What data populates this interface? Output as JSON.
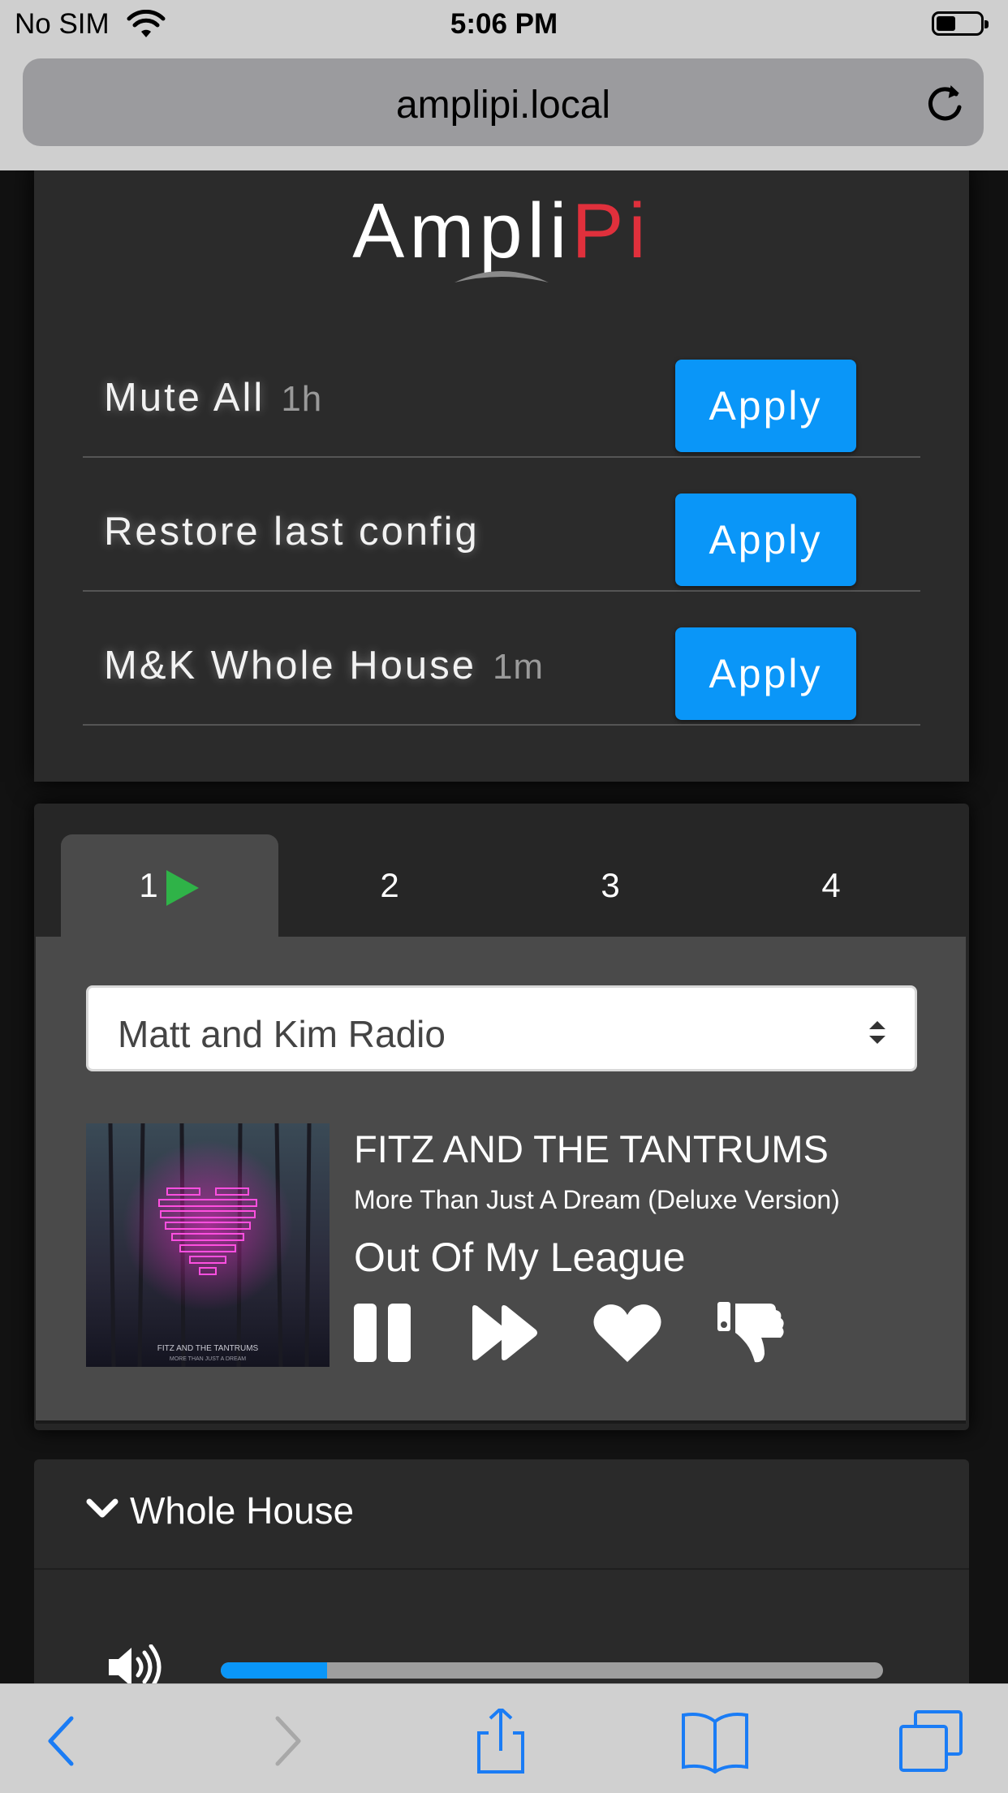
{
  "status_bar": {
    "carrier": "No SIM",
    "time": "5:06 PM",
    "battery_percent": 45
  },
  "browser": {
    "url": "amplipi.local"
  },
  "app": {
    "logo_main": "Ampli",
    "logo_accent": "Pi",
    "accent_color": "#e0303c",
    "button_color": "#0a96f8"
  },
  "presets": [
    {
      "name": "Mute All",
      "age": "1h",
      "button": "Apply"
    },
    {
      "name": "Restore last config",
      "age": "",
      "button": "Apply"
    },
    {
      "name": "M&K Whole House",
      "age": "1m",
      "button": "Apply"
    }
  ],
  "player": {
    "tabs": [
      "1",
      "2",
      "3",
      "4"
    ],
    "active_tab": "1",
    "source": "Matt and Kim Radio",
    "artist": "FITZ AND THE TANTRUMS",
    "album": "More Than Just A Dream (Deluxe Version)",
    "track": "Out Of My League",
    "art_text_line1": "FITZ AND THE TANTRUMS",
    "art_text_line2": "MORE THAN JUST A DREAM",
    "controls": [
      "pause-icon",
      "skip-forward-icon",
      "heart-icon",
      "thumbs-down-icon"
    ]
  },
  "zone_group": {
    "name": "Whole House",
    "volume_fraction": 0.16
  },
  "toolbar": [
    "back-icon",
    "forward-icon",
    "share-icon",
    "bookmarks-icon",
    "tabs-icon"
  ]
}
